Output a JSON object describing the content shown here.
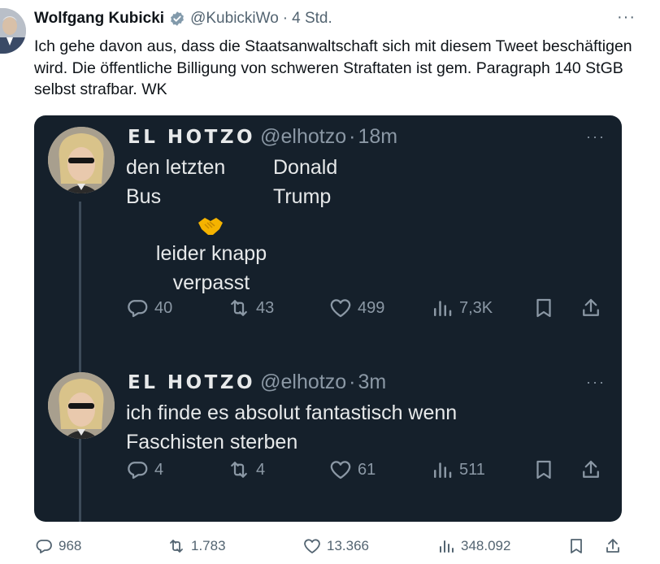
{
  "tweet": {
    "author_name": "Wolfgang Kubicki",
    "handle": "@KubickiWo",
    "separator": "·",
    "time": "4 Std.",
    "text": "Ich gehe davon aus, dass die Staatsanwaltschaft sich mit diesem Tweet beschäftigen wird. Die öffentliche Billigung von schweren Straftaten ist gem. Paragraph 140 StGB selbst strafbar. WK",
    "more": "···",
    "stats": {
      "replies": "968",
      "retweets": "1.783",
      "likes": "13.366",
      "views": "348.092"
    }
  },
  "embed": {
    "tweets": [
      {
        "name": "EL HOTZO",
        "handle": "@elhotzo",
        "separator": "·",
        "time": "18m",
        "more": "···",
        "text_left_1": "den letzten",
        "text_left_2": "Bus",
        "text_right_1": "Donald",
        "text_right_2": "Trump",
        "caption_1": "leider knapp",
        "caption_2": "verpasst",
        "replies": "40",
        "retweets": "43",
        "likes": "499",
        "views": "7,3K"
      },
      {
        "name": "EL HOTZO",
        "handle": "@elhotzo",
        "separator": "·",
        "time": "3m",
        "more": "···",
        "text_1": "ich finde es absolut fantastisch wenn",
        "text_2": "Faschisten sterben",
        "replies": "4",
        "retweets": "4",
        "likes": "61",
        "views": "511"
      }
    ]
  },
  "icons": [
    "verified-badge-icon",
    "reply-icon",
    "retweet-icon",
    "like-icon",
    "views-icon",
    "bookmark-icon",
    "share-icon",
    "handshake-emoji-icon",
    "more-icon"
  ],
  "colors": {
    "verified": "#829aab",
    "embed_bg": "#15202b",
    "muted": "#536471",
    "emoji": "#f5b300"
  }
}
